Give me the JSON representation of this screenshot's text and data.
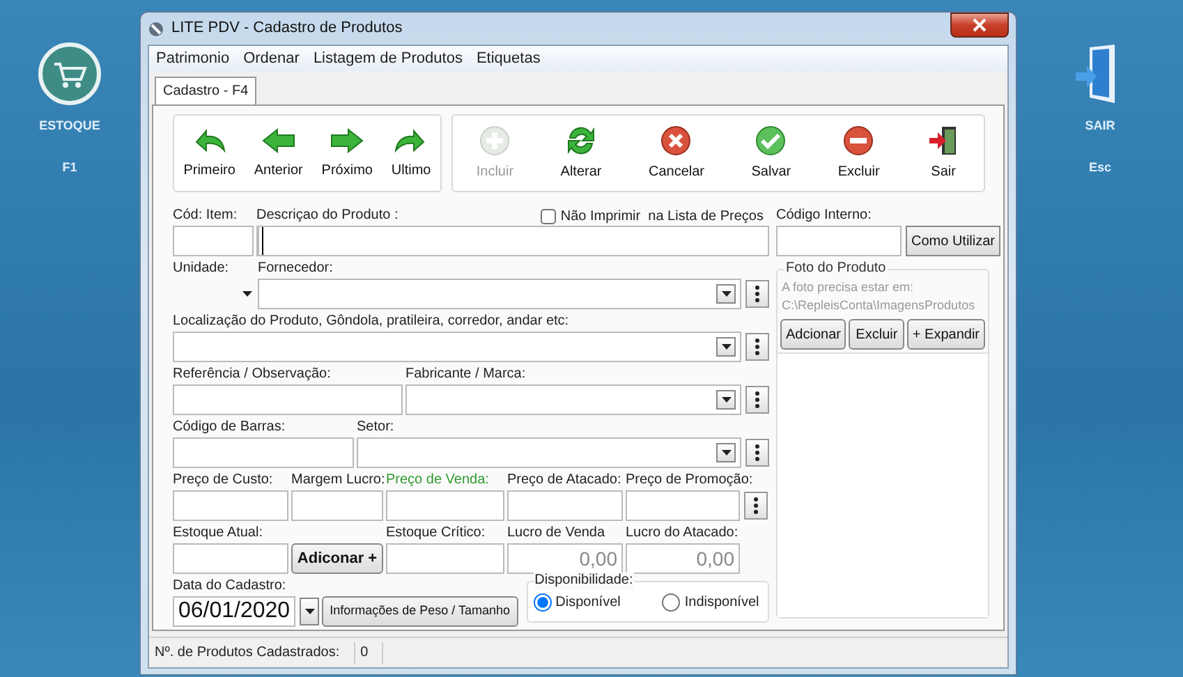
{
  "desktop": {
    "left_shortcut": {
      "label": "ESTOQUE",
      "key": "F1"
    },
    "right_shortcut": {
      "label": "SAIR",
      "key": "Esc"
    }
  },
  "window": {
    "title": "LITE PDV - Cadastro de Produtos"
  },
  "menu": [
    "Patrimonio",
    "Ordenar",
    "Listagem de Produtos",
    "Etiquetas"
  ],
  "tabs": [
    {
      "label": "Cadastro - F4",
      "selected": true
    }
  ],
  "toolbar": {
    "nav_buttons": [
      {
        "label": "Primeiro",
        "kind": "first",
        "disabled": false
      },
      {
        "label": "Anterior",
        "kind": "prev",
        "disabled": false
      },
      {
        "label": "Próximo",
        "kind": "next",
        "disabled": false
      },
      {
        "label": "Ultimo",
        "kind": "last",
        "disabled": false
      }
    ],
    "action_buttons": [
      {
        "label": "Incluir",
        "kind": "add",
        "disabled": true
      },
      {
        "label": "Alterar",
        "kind": "refresh",
        "disabled": false
      },
      {
        "label": "Cancelar",
        "kind": "cancel",
        "disabled": false
      },
      {
        "label": "Salvar",
        "kind": "save",
        "disabled": false
      },
      {
        "label": "Excluir",
        "kind": "delete",
        "disabled": false
      },
      {
        "label": "Sair",
        "kind": "exit",
        "disabled": false
      }
    ]
  },
  "form": {
    "rows": [
      [
        {
          "kind": "text",
          "label": "Cód: Item:"
        },
        {
          "kind": "text",
          "label": "Descriçao do Produto :",
          "focused": true,
          "option": {
            "label": "Não Imprimir  na Lista de Preços",
            "checked": false
          }
        }
      ],
      [
        {
          "kind": "select",
          "label": "Unidade:"
        },
        {
          "kind": "combo",
          "label": "Fornecedor:",
          "menu_button": true
        }
      ],
      [
        {
          "kind": "combo",
          "label": "Localização do Produto, Gôndola, pratileira, corredor, andar etc:",
          "menu_button": true
        }
      ],
      [
        {
          "kind": "text",
          "label": "Referência / Observação:"
        },
        {
          "kind": "combo",
          "label": "Fabricante / Marca:",
          "menu_button": true
        }
      ],
      [
        {
          "kind": "text",
          "label": "Código de Barras:"
        },
        {
          "kind": "combo",
          "label": "Setor:",
          "menu_button": true
        }
      ],
      [
        {
          "kind": "text",
          "label": "Preço de Custo:"
        },
        {
          "kind": "text",
          "label": "Margem Lucro:"
        },
        {
          "kind": "text",
          "label": "Preço de Venda:",
          "color": "#2e9a2e"
        },
        {
          "kind": "text",
          "label": "Preço de Atacado:"
        },
        {
          "kind": "text",
          "label": "Preço de Promoção:",
          "menu_button": true
        }
      ],
      [
        {
          "kind": "text",
          "label": "Estoque Atual:"
        },
        {
          "kind": "button",
          "label": "Adiconar +"
        },
        {
          "kind": "text",
          "label": "Estoque Crítico:"
        },
        {
          "kind": "readonly",
          "label": "Lucro de Venda",
          "value": "0,00"
        },
        {
          "kind": "readonly",
          "label": "Lucro do Atacado:",
          "value": "0,00"
        }
      ]
    ],
    "footer": {
      "date": {
        "label": "Data do Cadastro:",
        "value": "06/01/2020"
      },
      "button": "Informações de Peso / Tamanho",
      "availability": {
        "label": "Disponibilidade:",
        "options": [
          {
            "label": "Disponível",
            "selected": true
          },
          {
            "label": "Indisponível",
            "selected": false
          }
        ]
      }
    }
  },
  "side": {
    "code_label": "Código Interno:",
    "help_button": "Como Utilizar",
    "photo": {
      "legend": "Foto do Produto",
      "hint": [
        "A foto precisa estar em:",
        "C:\\RepleisConta\\ImagensProdutos"
      ],
      "buttons": [
        "Adcionar",
        "Excluir",
        "+ Expandir"
      ]
    }
  },
  "status_bar": [
    {
      "text": "Nº. de Produtos Cadastrados:"
    },
    {
      "text": "0"
    }
  ]
}
